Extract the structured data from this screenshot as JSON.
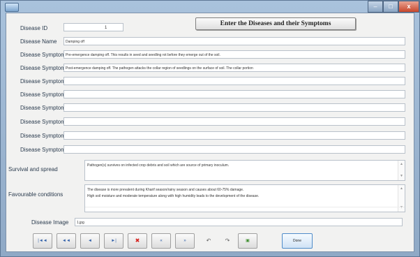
{
  "window": {
    "controls": {
      "minimize": "–",
      "maximize": "□",
      "close": "x"
    }
  },
  "header": {
    "title": "Enter the Diseases and their Symptoms"
  },
  "fields": {
    "disease_id": {
      "label": "Disease ID",
      "value": "1"
    },
    "disease_name": {
      "label": "Disease Name",
      "value": "Damping off"
    },
    "symptom1": {
      "label": "Disease Symptom1",
      "value": "Pre-emergence damping off. This results in seed and seedling rot before they emerge out of the soil."
    },
    "symptom2": {
      "label": "Disease Symptom2",
      "value": "Post-emergence damping off. The pathogen attacks the collar region of seedlings on the surface of soil. The collar portion"
    },
    "symptom3": {
      "label": "Disease Symptom3",
      "value": ""
    },
    "symptom4": {
      "label": "Disease Symptom4",
      "value": ""
    },
    "symptom5": {
      "label": "Disease Symptom5",
      "value": ""
    },
    "symptom6": {
      "label": "Disease Symptom6",
      "value": ""
    },
    "symptom7": {
      "label": "Disease Symptom7",
      "value": ""
    },
    "symptom8": {
      "label": "Disease Symptom8",
      "value": ""
    },
    "survival_spread": {
      "label": "Survival and spread",
      "lines": [
        "Pathogen(s) survives on infected crop debris and soil which are source of primary inoculum."
      ]
    },
    "favourable_conditions": {
      "label": "Favourable conditions",
      "lines": [
        "The disease is more prevalent during Kharif season/rainy season and causes about 60-75% damage.",
        "High soil moisture and moderate temperature along with high humidity leads to the development of the disease."
      ]
    },
    "disease_image": {
      "label": "Disease Image",
      "value": "1.jpg"
    }
  },
  "navigation": {
    "buttons": [
      {
        "icon": "first-record-icon",
        "glyph": "|◄◄"
      },
      {
        "icon": "previous-page-icon",
        "glyph": "◄◄"
      },
      {
        "icon": "previous-record-icon",
        "glyph": "◄"
      },
      {
        "icon": "next-record-icon",
        "glyph": "►|"
      },
      {
        "icon": "delete-icon",
        "glyph": "✖"
      },
      {
        "icon": "first-page-icon",
        "glyph": "«"
      },
      {
        "icon": "last-page-icon",
        "glyph": "»"
      },
      {
        "icon": "undo-icon",
        "glyph": "↶"
      },
      {
        "icon": "redo-icon",
        "glyph": "↷"
      },
      {
        "icon": "save-icon",
        "glyph": "▣"
      }
    ],
    "done_label": "Done"
  }
}
